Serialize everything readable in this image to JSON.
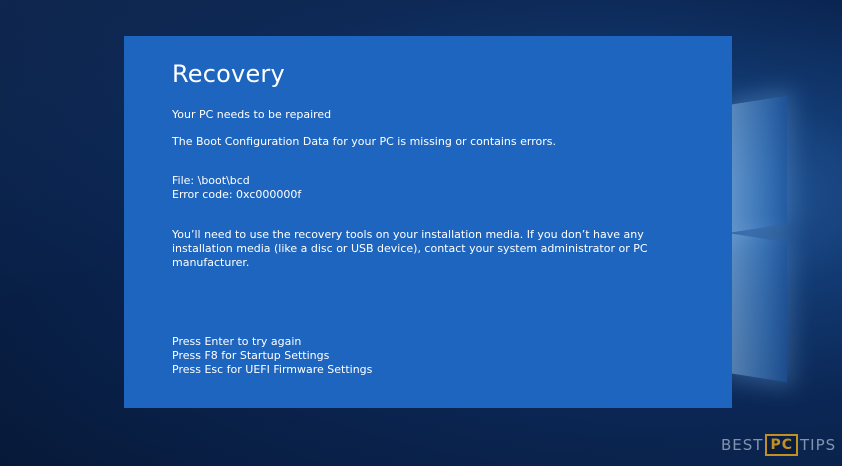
{
  "recovery": {
    "title": "Recovery",
    "subtitle": "Your PC needs to be repaired",
    "description": "The Boot Configuration Data for your PC is missing or contains errors.",
    "file": "File: \\boot\\bcd",
    "error_code": "Error code: 0xc000000f",
    "instructions": "You’ll need to use the recovery tools on your installation media. If you don’t have any installation media (like a disc or USB device), contact your system administrator or PC manufacturer.",
    "options": [
      "Press Enter to try again",
      "Press F8 for Startup Settings",
      "Press Esc for UEFI Firmware Settings"
    ]
  },
  "watermark": {
    "left": "BEST",
    "badge": "PC",
    "right": "TIPS"
  },
  "colors": {
    "dialog_background": "#1e65bf",
    "text": "#ffffff",
    "watermark_accent": "#e2a21a"
  }
}
